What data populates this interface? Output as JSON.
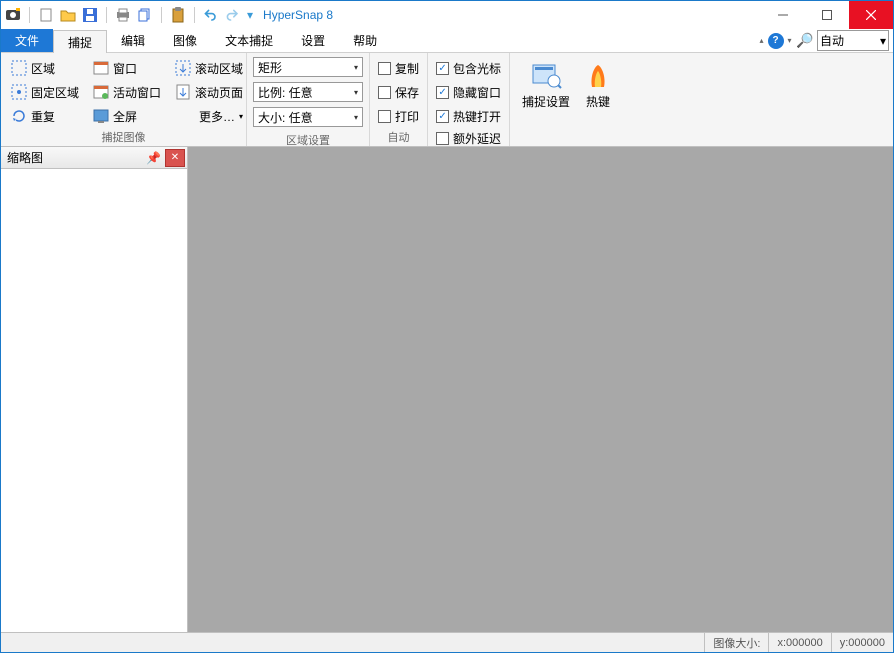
{
  "app": {
    "title": "HyperSnap 8"
  },
  "menu": {
    "file": "文件",
    "capture": "捕捉",
    "edit": "编辑",
    "image": "图像",
    "textcap": "文本捕捉",
    "settings": "设置",
    "help": "帮助",
    "zoom": "自动"
  },
  "ribbon": {
    "group1": {
      "label": "捕捉图像",
      "region": "区域",
      "window": "窗口",
      "fixed_region": "固定区域",
      "active_window": "活动窗口",
      "repeat": "重复",
      "fullscreen": "全屏",
      "scroll_region": "滚动区域",
      "scroll_page": "滚动页面",
      "more": "更多…"
    },
    "group2": {
      "label": "区域设置",
      "shape": "矩形",
      "ratio": "比例: 任意",
      "size": "大小: 任意"
    },
    "group3": {
      "label": "自动",
      "copy": "复制",
      "save": "保存",
      "print": "打印"
    },
    "group4": {
      "include_cursor": "包含光标",
      "hide_window": "隐藏窗口",
      "hotkey_open": "热键打开",
      "extra_delay": "额外延迟"
    },
    "group5": {
      "cap_settings": "捕捉设置",
      "hotkeys": "热键"
    }
  },
  "panel": {
    "title": "缩略图"
  },
  "status": {
    "size_label": "图像大小:",
    "x": "x:000000",
    "y": "y:000000"
  }
}
